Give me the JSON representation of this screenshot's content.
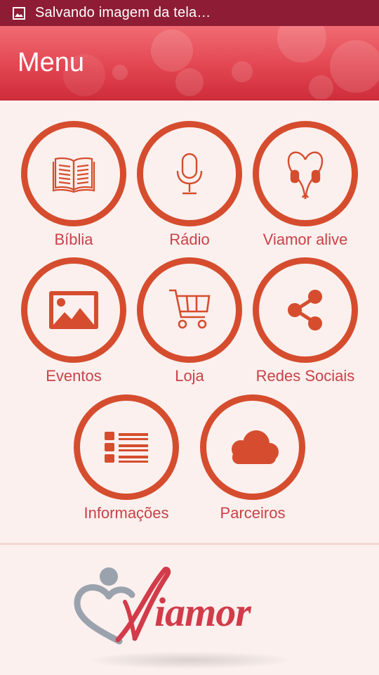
{
  "status_bar": {
    "notification_icon": "image-icon",
    "text": "Salvando imagem da tela…"
  },
  "app_bar": {
    "title": "Menu"
  },
  "menu_items": [
    {
      "label": "Bíblia",
      "icon": "book-icon"
    },
    {
      "label": "Rádio",
      "icon": "microphone-icon"
    },
    {
      "label": "Viamor alive",
      "icon": "heart-headphones-icon"
    },
    {
      "label": "Eventos",
      "icon": "image-icon"
    },
    {
      "label": "Loja",
      "icon": "shopping-cart-icon"
    },
    {
      "label": "Redes Sociais",
      "icon": "share-icon"
    },
    {
      "label": "Informações",
      "icon": "list-icon"
    },
    {
      "label": "Parceiros",
      "icon": "cloud-icon"
    }
  ],
  "footer": {
    "logo_text": "Viamor"
  },
  "colors": {
    "status_bar": "#8e1c34",
    "app_bar": "#e24651",
    "accent": "#d54d2e",
    "label": "#c94147",
    "background": "#fbf0ee"
  }
}
